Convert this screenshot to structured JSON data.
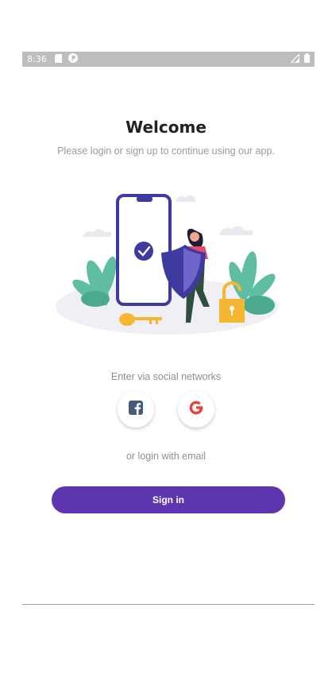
{
  "status_bar": {
    "time": "8:36",
    "left_icons": [
      "sd-card-icon",
      "p-app-icon"
    ],
    "right_icons": [
      "signal-icon",
      "battery-icon"
    ],
    "background": "#bdbdbd"
  },
  "welcome": {
    "title": "Welcome",
    "subtitle": "Please login or sign up to continue using our app."
  },
  "social": {
    "caption": "Enter via social networks",
    "buttons": [
      {
        "icon": "facebook-icon",
        "color": "#3b5998"
      },
      {
        "icon": "google-icon",
        "color": "#ea4335"
      }
    ]
  },
  "email": {
    "caption": "or login with email"
  },
  "signin": {
    "label": "Sign in",
    "color": "#5e35b1"
  }
}
